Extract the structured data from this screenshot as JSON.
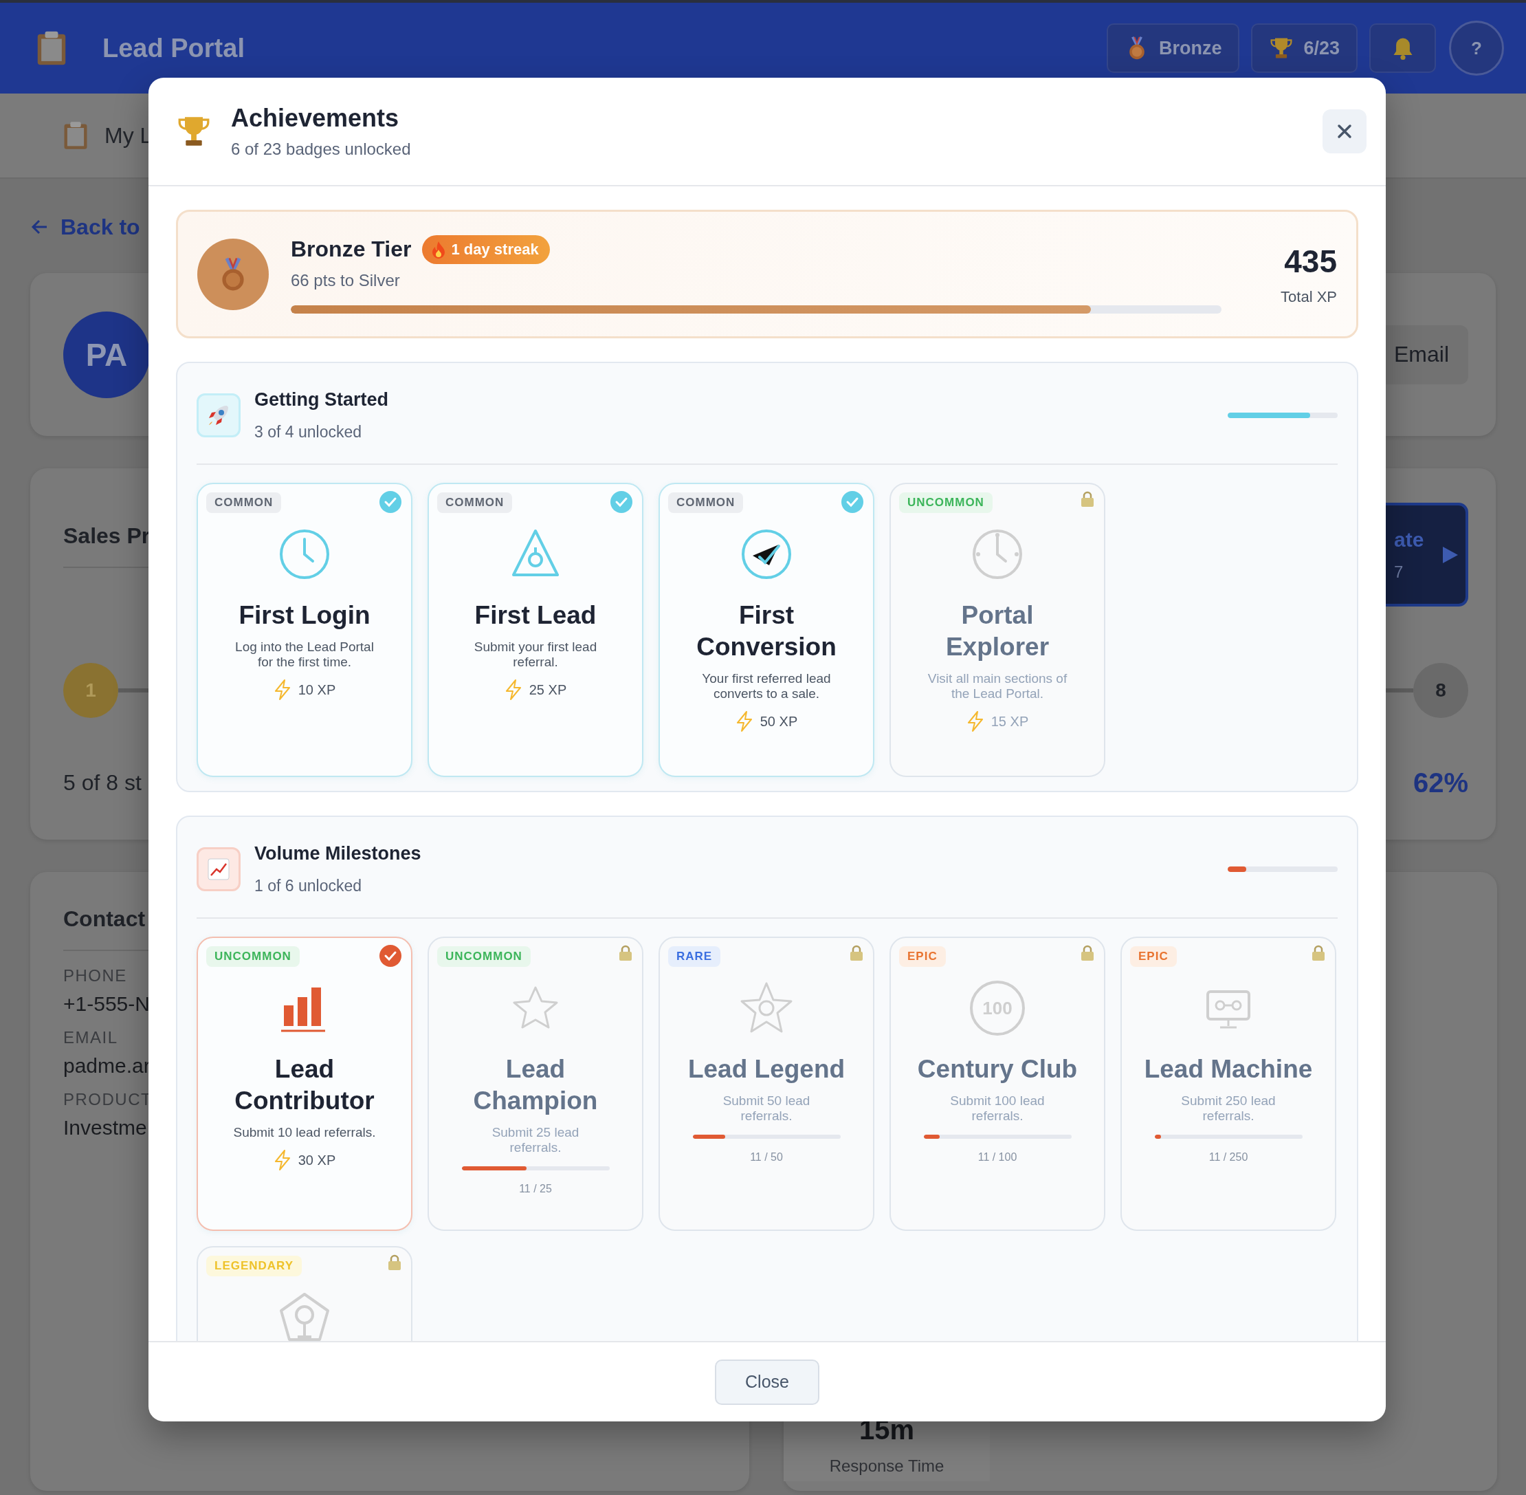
{
  "header": {
    "title": "Lead Portal",
    "tier": "Bronze",
    "badges": "6/23",
    "help": "?"
  },
  "subnav": {
    "label": "My L"
  },
  "back_link": "Back to",
  "profile": {
    "initials": "PA",
    "email_button": "Email"
  },
  "sales_progress": {
    "title": "Sales Pr",
    "action_button": {
      "label": "ate",
      "sub": "7"
    },
    "steps": [
      {
        "label": "1",
        "done": true
      },
      {
        "label": "8",
        "done": false
      }
    ],
    "summary": "5 of 8 st",
    "percent": "62%"
  },
  "contact": {
    "title": "Contact",
    "fields": [
      {
        "label": "PHONE",
        "value": "+1-555-N"
      },
      {
        "label": "EMAIL",
        "value": "padme.ar"
      },
      {
        "label": "PRODUCT",
        "value": "Investme"
      }
    ]
  },
  "stat": {
    "value": "15m",
    "label": "Response Time"
  },
  "modal": {
    "title": "Achievements",
    "subtitle": "6 of 23 badges unlocked",
    "tier": {
      "name": "Bronze Tier",
      "streak": "1 day streak",
      "next": "66 pts to Silver",
      "level": 0.86,
      "xp": "435",
      "xp_label": "Total XP"
    },
    "sections": [
      {
        "title": "Getting Started",
        "summary": "3 of 4 unlocked",
        "level": 0.75,
        "badges": [
          {
            "rarity": "COMMON",
            "kind": "common",
            "unlocked": true,
            "title": "First Login",
            "description": "Log into the Lead Portal for the first time.",
            "xp": "10 XP"
          },
          {
            "rarity": "COMMON",
            "kind": "common",
            "unlocked": true,
            "title": "First Lead",
            "description": "Submit your first lead referral.",
            "xp": "25 XP"
          },
          {
            "rarity": "COMMON",
            "kind": "common",
            "unlocked": true,
            "title": "First Conversion",
            "description": "Your first referred lead converts to a sale.",
            "xp": "50 XP"
          },
          {
            "rarity": "UNCOMMON",
            "kind": "uncommon",
            "unlocked": false,
            "title": "Portal Explorer",
            "description": "Visit all main sections of the Lead Portal.",
            "xp": "15 XP"
          }
        ]
      },
      {
        "title": "Volume Milestones",
        "summary": "1 of 6 unlocked",
        "level": 0.17,
        "badges": [
          {
            "rarity": "UNCOMMON",
            "kind": "uncommon",
            "unlocked": true,
            "title": "Lead Contributor",
            "description": "Submit 10 lead referrals.",
            "xp": "30 XP"
          },
          {
            "rarity": "UNCOMMON",
            "kind": "uncommon",
            "unlocked": false,
            "title": "Lead Champion",
            "description": "Submit 25 lead referrals.",
            "progress": {
              "level": 0.44,
              "text": "11 / 25"
            }
          },
          {
            "rarity": "RARE",
            "kind": "rare",
            "unlocked": false,
            "title": "Lead Legend",
            "description": "Submit 50 lead referrals.",
            "progress": {
              "level": 0.22,
              "text": "11 / 50"
            }
          },
          {
            "rarity": "EPIC",
            "kind": "epic",
            "unlocked": false,
            "badge_text": "100",
            "title": "Century Club",
            "description": "Submit 100 lead referrals.",
            "progress": {
              "level": 0.11,
              "text": "11 / 100"
            }
          },
          {
            "rarity": "EPIC",
            "kind": "epic",
            "unlocked": false,
            "title": "Lead Machine",
            "description": "Submit 250 lead referrals.",
            "progress": {
              "level": 0.044,
              "text": "11 / 250"
            }
          },
          {
            "rarity": "LEGENDARY",
            "kind": "legendary",
            "unlocked": false
          }
        ]
      }
    ],
    "close_button": "Close"
  }
}
